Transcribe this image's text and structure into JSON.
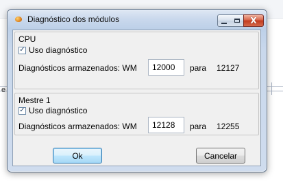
{
  "window": {
    "title": "Diagnóstico dos módulos",
    "close_glyph": "X"
  },
  "background": {
    "edge_mark": "e"
  },
  "groups": [
    {
      "title": "CPU",
      "checkbox_label": "Uso diagnóstico",
      "checked": true,
      "stored_label": "Diagnósticos armazenados: WM",
      "start_value": "12000",
      "para_label": "para",
      "end_value": "12127"
    },
    {
      "title": "Mestre 1",
      "checkbox_label": "Uso diagnóstico",
      "checked": true,
      "stored_label": "Diagnósticos armazenados: WM",
      "start_value": "12128",
      "para_label": "para",
      "end_value": "12255"
    }
  ],
  "buttons": {
    "ok": "Ok",
    "cancel": "Cancelar"
  },
  "icons": {
    "app": "app-icon",
    "check": "checkmark-icon"
  }
}
